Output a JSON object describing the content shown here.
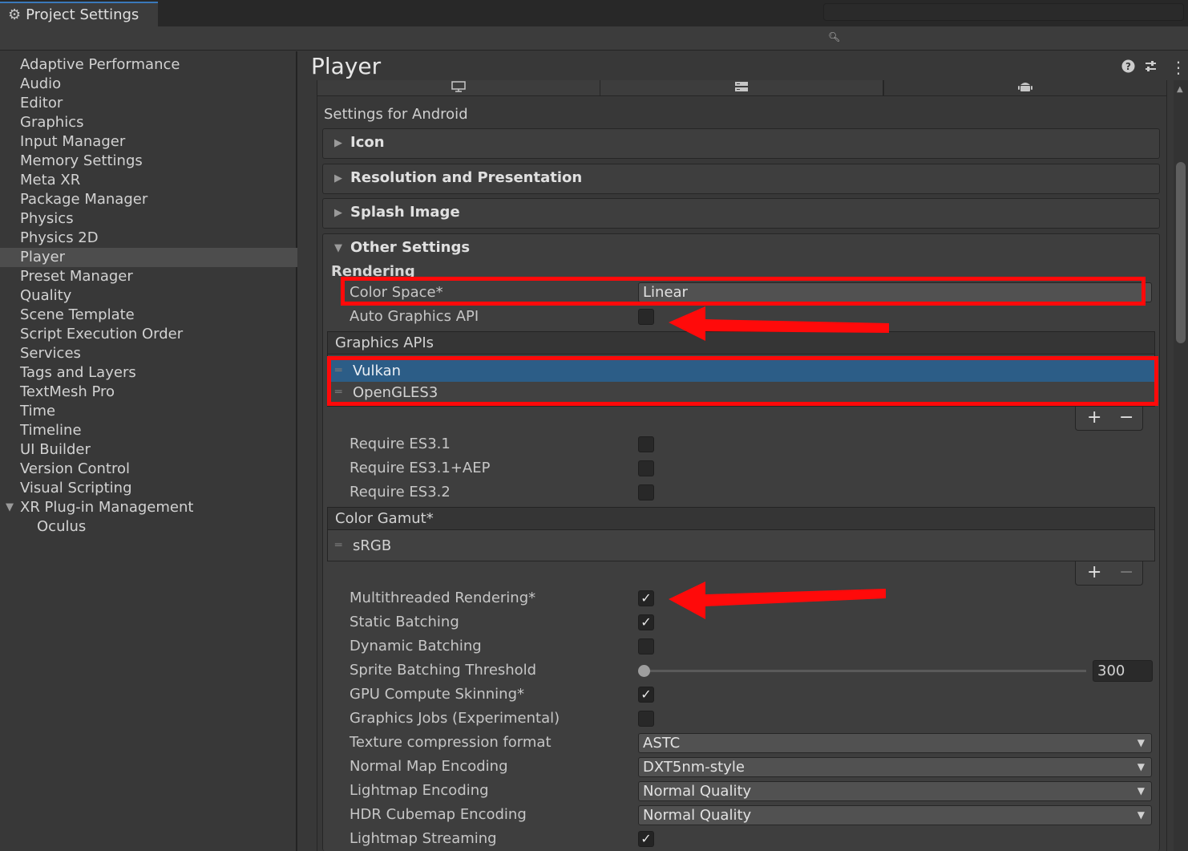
{
  "window": {
    "tab_title": "Project Settings",
    "icons": [
      "gear-icon",
      "kebab-menu-icon",
      "maximize-icon",
      "close-icon"
    ]
  },
  "search": {
    "value": "",
    "placeholder": ""
  },
  "sidebar": {
    "items": [
      {
        "label": "Adaptive Performance"
      },
      {
        "label": "Audio"
      },
      {
        "label": "Editor"
      },
      {
        "label": "Graphics"
      },
      {
        "label": "Input Manager"
      },
      {
        "label": "Memory Settings"
      },
      {
        "label": "Meta XR"
      },
      {
        "label": "Package Manager"
      },
      {
        "label": "Physics"
      },
      {
        "label": "Physics 2D"
      },
      {
        "label": "Player",
        "selected": true
      },
      {
        "label": "Preset Manager"
      },
      {
        "label": "Quality"
      },
      {
        "label": "Scene Template"
      },
      {
        "label": "Script Execution Order"
      },
      {
        "label": "Services"
      },
      {
        "label": "Tags and Layers"
      },
      {
        "label": "TextMesh Pro"
      },
      {
        "label": "Time"
      },
      {
        "label": "Timeline"
      },
      {
        "label": "UI Builder"
      },
      {
        "label": "Version Control"
      },
      {
        "label": "Visual Scripting"
      },
      {
        "label": "XR Plug-in Management",
        "expanded": true
      },
      {
        "label": "Oculus",
        "child": true
      }
    ]
  },
  "main": {
    "title": "Player",
    "header_icons": [
      "help-icon",
      "preset-icon",
      "kebab-menu-icon"
    ],
    "platform_tabs": [
      {
        "icon": "monitor-icon"
      },
      {
        "icon": "server-icon"
      },
      {
        "icon": "android-icon",
        "active": true
      }
    ],
    "settings_for": "Settings for Android",
    "sections": {
      "icon": "Icon",
      "resolution": "Resolution and Presentation",
      "splash": "Splash Image",
      "other": "Other Settings"
    },
    "rendering_header": "Rendering",
    "color_space": {
      "label": "Color Space*",
      "value": "Linear"
    },
    "auto_graphics_api": {
      "label": "Auto Graphics API",
      "checked": false
    },
    "graphics_apis": {
      "header": "Graphics APIs",
      "items": [
        {
          "label": "Vulkan",
          "selected": true
        },
        {
          "label": "OpenGLES3"
        }
      ],
      "add": "+",
      "remove": "−"
    },
    "require_es31": {
      "label": "Require ES3.1",
      "checked": false
    },
    "require_es31_aep": {
      "label": "Require ES3.1+AEP",
      "checked": false
    },
    "require_es32": {
      "label": "Require ES3.2",
      "checked": false
    },
    "color_gamut": {
      "header": "Color Gamut*",
      "items": [
        {
          "label": "sRGB"
        }
      ],
      "add": "+",
      "remove": "−"
    },
    "multithreaded_rendering": {
      "label": "Multithreaded Rendering*",
      "checked": true
    },
    "static_batching": {
      "label": "Static Batching",
      "checked": true
    },
    "dynamic_batching": {
      "label": "Dynamic Batching",
      "checked": false
    },
    "sprite_batching_threshold": {
      "label": "Sprite Batching Threshold",
      "value": "300",
      "slider_fraction": 0.0
    },
    "gpu_compute_skinning": {
      "label": "GPU Compute Skinning*",
      "checked": true
    },
    "graphics_jobs": {
      "label": "Graphics Jobs (Experimental)",
      "checked": false
    },
    "texture_compression": {
      "label": "Texture compression format",
      "value": "ASTC"
    },
    "normal_map_encoding": {
      "label": "Normal Map Encoding",
      "value": "DXT5nm-style"
    },
    "lightmap_encoding": {
      "label": "Lightmap Encoding",
      "value": "Normal Quality"
    },
    "hdr_cubemap_encoding": {
      "label": "HDR Cubemap Encoding",
      "value": "Normal Quality"
    },
    "lightmap_streaming": {
      "label": "Lightmap Streaming",
      "checked": true
    }
  },
  "annotations": {
    "highlight_color": "#ff0a0a"
  },
  "colors": {
    "accent_tab": "#3a79bb",
    "selection": "#2c5d87",
    "background": "#383838"
  }
}
